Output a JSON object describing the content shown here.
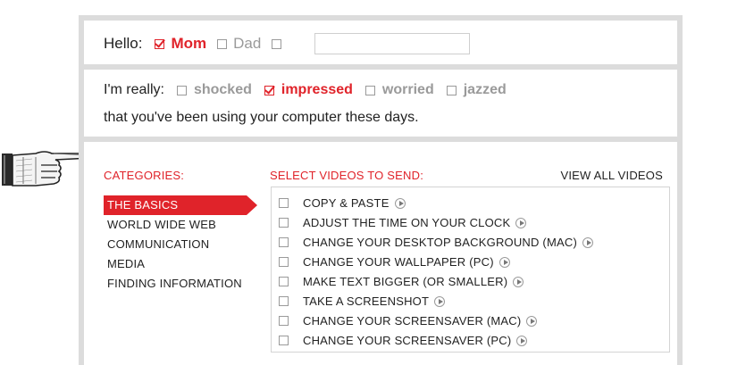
{
  "greeting": {
    "label": "Hello:",
    "options": [
      {
        "label": "Mom",
        "checked": true
      },
      {
        "label": "Dad",
        "checked": false
      },
      {
        "label": "",
        "checked": false
      }
    ],
    "name_input_value": ""
  },
  "feeling": {
    "label": "I'm really:",
    "options": [
      {
        "label": "shocked",
        "checked": false
      },
      {
        "label": "impressed",
        "checked": true
      },
      {
        "label": "worried",
        "checked": false
      },
      {
        "label": "jazzed",
        "checked": false
      }
    ],
    "tagline": "that you've been using your computer these days."
  },
  "categories": {
    "heading": "CATEGORIES:",
    "items": [
      "THE BASICS",
      "WORLD WIDE WEB",
      "COMMUNICATION",
      "MEDIA",
      "FINDING INFORMATION"
    ],
    "selected": "THE BASICS"
  },
  "videos": {
    "heading": "SELECT VIDEOS TO SEND:",
    "view_all": "VIEW ALL VIDEOS",
    "items": [
      "COPY & PASTE",
      "ADJUST THE TIME ON YOUR CLOCK",
      "CHANGE YOUR DESKTOP BACKGROUND (MAC)",
      "CHANGE YOUR WALLPAPER (PC)",
      "MAKE TEXT BIGGER (OR SMALLER)",
      "TAKE A SCREENSHOT",
      "CHANGE YOUR SCREENSAVER (MAC)",
      "CHANGE YOUR SCREENSAVER (PC)"
    ]
  },
  "colors": {
    "accent": "#e0232a",
    "muted": "#9a9a9a",
    "frame": "#dcdcdc"
  },
  "icons": [
    "pointing-hand-icon",
    "checkbox-icon",
    "play-icon"
  ]
}
